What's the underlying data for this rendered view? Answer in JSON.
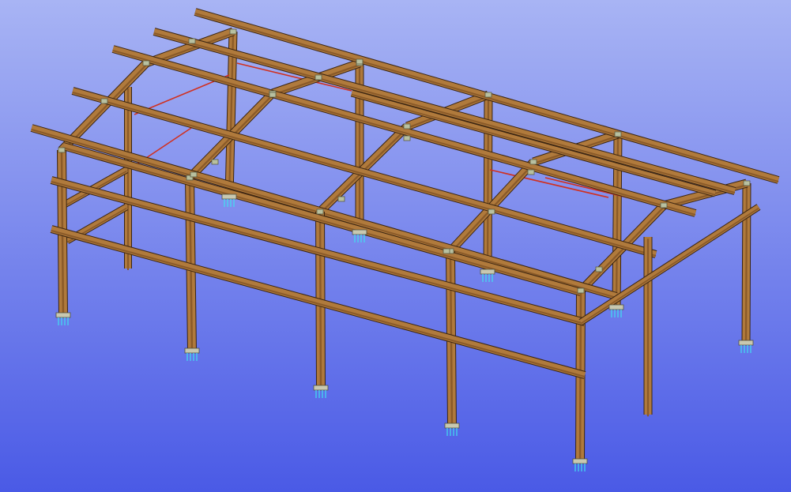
{
  "viewport": {
    "background_top": "#a8b4f4",
    "background_bottom": "#4a5ae6"
  },
  "frame": {
    "member_fill": "#b07a3c",
    "member_edge": "#3a2410",
    "member_shade": "#8a5a28",
    "bracing_color": "#d03020",
    "connection_plate_color": "#b8c0a0",
    "anchor_bolt_color": "#40e0f0",
    "baseplate_color": "#c8c8b0",
    "bays": 5,
    "frame_lines": 6
  }
}
